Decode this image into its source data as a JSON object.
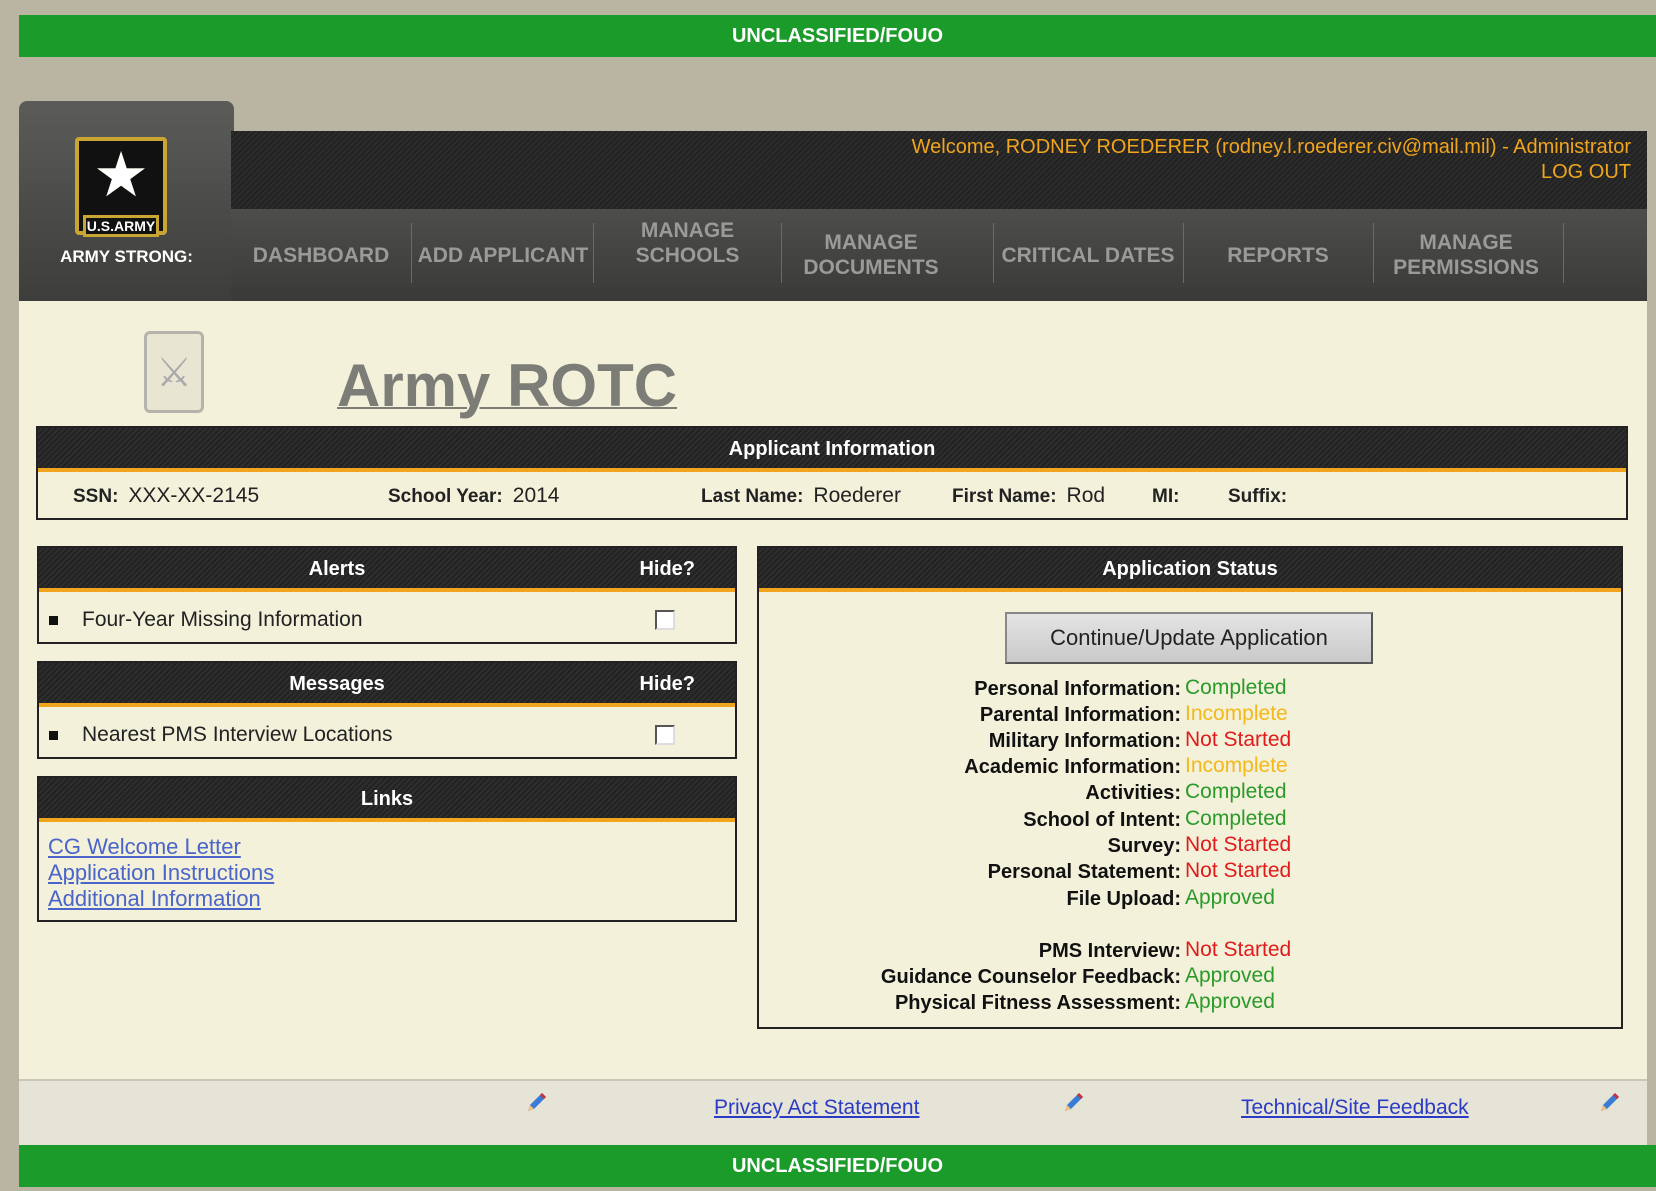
{
  "banner": {
    "top": "UNCLASSIFIED/FOUO",
    "bottom": "UNCLASSIFIED/FOUO"
  },
  "logo": {
    "badge_text": "U.S.ARMY",
    "tagline": "ARMY STRONG:"
  },
  "header": {
    "welcome": "Welcome, RODNEY ROEDERER (rodney.l.roederer.civ@mail.mil) - Administrator",
    "logout": "LOG OUT"
  },
  "nav": [
    {
      "label": "DASHBOARD"
    },
    {
      "label": "ADD APPLICANT"
    },
    {
      "label": "MANAGE SCHOOLS"
    },
    {
      "label": "MANAGE DOCUMENTS"
    },
    {
      "label": "CRITICAL DATES"
    },
    {
      "label": "REPORTS"
    },
    {
      "label": "MANAGE PERMISSIONS"
    }
  ],
  "page_title": "Army ROTC",
  "applicant": {
    "title": "Applicant Information",
    "ssn_label": "SSN:",
    "ssn": "XXX-XX-2145",
    "year_label": "School Year:",
    "year": "2014",
    "last_label": "Last Name:",
    "last": "Roederer",
    "first_label": "First Name:",
    "first": "Rod",
    "mi_label": "MI:",
    "mi": "",
    "suffix_label": "Suffix:",
    "suffix": ""
  },
  "alerts": {
    "title": "Alerts",
    "hide": "Hide?",
    "item": "Four-Year Missing Information"
  },
  "messages": {
    "title": "Messages",
    "hide": "Hide?",
    "item": "Nearest PMS Interview Locations"
  },
  "links": {
    "title": "Links",
    "items": [
      "CG Welcome Letter",
      "Application Instructions",
      "Additional Information"
    ]
  },
  "status": {
    "title": "Application Status",
    "button": "Continue/Update Application",
    "rows": [
      {
        "label": "Personal Information:",
        "value": "Completed",
        "color": "#2a9a2a"
      },
      {
        "label": "Parental Information:",
        "value": "Incomplete",
        "color": "#f5b81b"
      },
      {
        "label": "Military Information:",
        "value": "Not Started",
        "color": "#e01b1b"
      },
      {
        "label": "Academic Information:",
        "value": "Incomplete",
        "color": "#f5b81b"
      },
      {
        "label": "Activities:",
        "value": "Completed",
        "color": "#2a9a2a"
      },
      {
        "label": "School of Intent:",
        "value": "Completed",
        "color": "#2a9a2a"
      },
      {
        "label": "Survey:",
        "value": "Not Started",
        "color": "#e01b1b"
      },
      {
        "label": "Personal Statement:",
        "value": "Not Started",
        "color": "#e01b1b"
      },
      {
        "label": "File Upload:",
        "value": "Approved",
        "color": "#2a9a2a"
      },
      {
        "label": "PMS Interview:",
        "value": "Not Started",
        "color": "#e01b1b"
      },
      {
        "label": "Guidance Counselor Feedback:",
        "value": "Approved",
        "color": "#2a9a2a"
      },
      {
        "label": "Physical Fitness Assessment:",
        "value": "Approved",
        "color": "#2a9a2a"
      }
    ]
  },
  "footer": {
    "privacy": "Privacy Act Statement",
    "feedback": "Technical/Site Feedback"
  }
}
